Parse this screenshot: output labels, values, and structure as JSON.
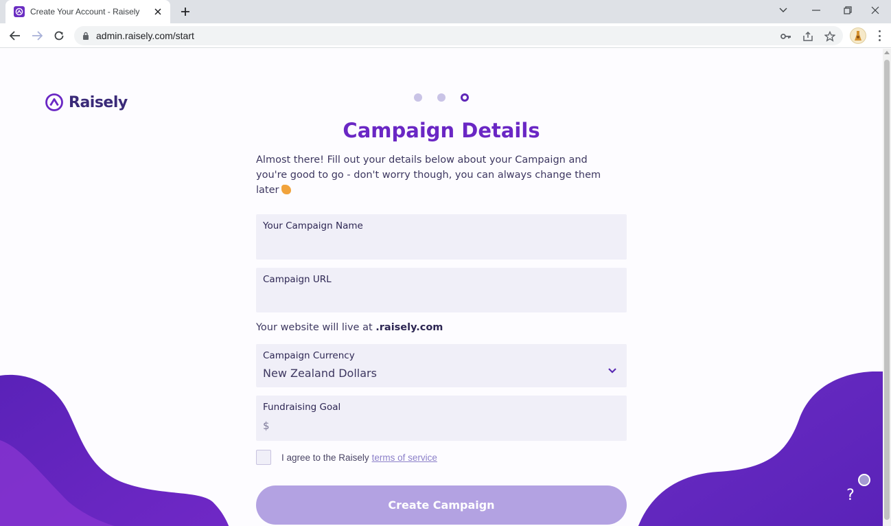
{
  "browser": {
    "tab_title": "Create Your Account - Raisely",
    "url": "admin.raisely.com/start"
  },
  "page": {
    "logo_text": "Raisely",
    "steps": [
      {
        "state": "complete"
      },
      {
        "state": "complete"
      },
      {
        "state": "current"
      }
    ],
    "title": "Campaign Details",
    "intro": "Almost there! Fill out your details below about your Campaign and you're good to go - don't worry though, you can always change them later",
    "fields": {
      "campaign_name": {
        "label": "Your Campaign Name",
        "value": ""
      },
      "campaign_url": {
        "label": "Campaign URL",
        "value": ""
      },
      "url_hint_prefix": "Your website will live at ",
      "url_hint_domain": ".raisely.com",
      "currency": {
        "label": "Campaign Currency",
        "value": "New Zealand Dollars"
      },
      "goal": {
        "label": "Fundraising Goal",
        "prefix": "$",
        "value": ""
      }
    },
    "terms": {
      "text": "I agree to the Raisely",
      "link": "terms of service",
      "checked": false
    },
    "submit_label": "Create Campaign",
    "help_label": "?"
  },
  "colors": {
    "brand_purple": "#6a27c4",
    "wave_purple": "#6b2cc4",
    "button_disabled": "#b3a2e2",
    "field_bg": "#f0eff8"
  }
}
